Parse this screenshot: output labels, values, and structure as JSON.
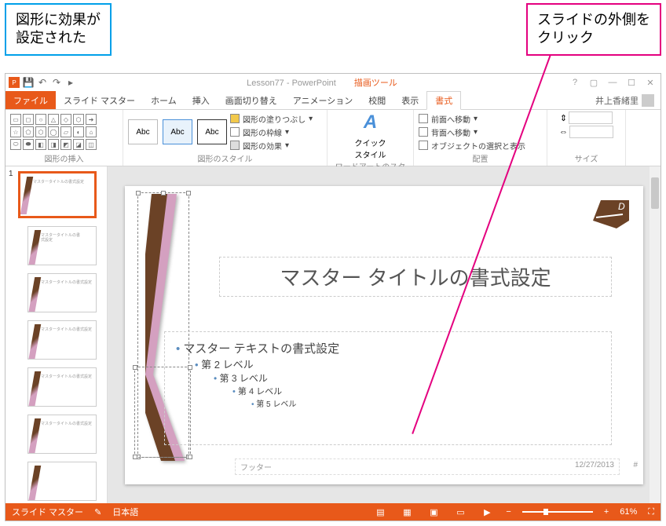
{
  "callouts": {
    "blue": "図形に効果が\n設定された",
    "pink": "スライドの外側を\nクリック"
  },
  "titlebar": {
    "doc_title": "Lesson77 - PowerPoint",
    "tool_context": "描画ツール"
  },
  "tabs": {
    "file": "ファイル",
    "slide_master": "スライド マスター",
    "home": "ホーム",
    "insert": "挿入",
    "transitions": "画面切り替え",
    "animation": "アニメーション",
    "review": "校閲",
    "view": "表示",
    "format": "書式"
  },
  "user_name": "井上香緒里",
  "ribbon": {
    "group_shapes": "図形の挿入",
    "group_styles": "図形のスタイル",
    "group_wordart": "ワードアートのスタイル",
    "group_arrange": "配置",
    "group_size": "サイズ",
    "swatch_label": "Abc",
    "shape_fill": "図形の塗りつぶし",
    "shape_outline": "図形の枠線",
    "shape_effects": "図形の効果",
    "quick_styles": "クイック\nスタイル",
    "bring_forward": "前面へ移動",
    "send_backward": "背面へ移動",
    "selection_pane": "オブジェクトの選択と表示"
  },
  "slide": {
    "master_title": "マスター タイトルの書式設定",
    "body_l1": "マスター テキストの書式設定",
    "body_l2": "第 2 レベル",
    "body_l3": "第 3 レベル",
    "body_l4": "第 4 レベル",
    "body_l5": "第 5 レベル",
    "footer_left": "フッター",
    "footer_right": "12/27/2013",
    "page_num": "#"
  },
  "statusbar": {
    "mode": "スライド マスター",
    "lang": "日本語",
    "zoom": "61%"
  },
  "thumbs": {
    "num1": "1"
  }
}
